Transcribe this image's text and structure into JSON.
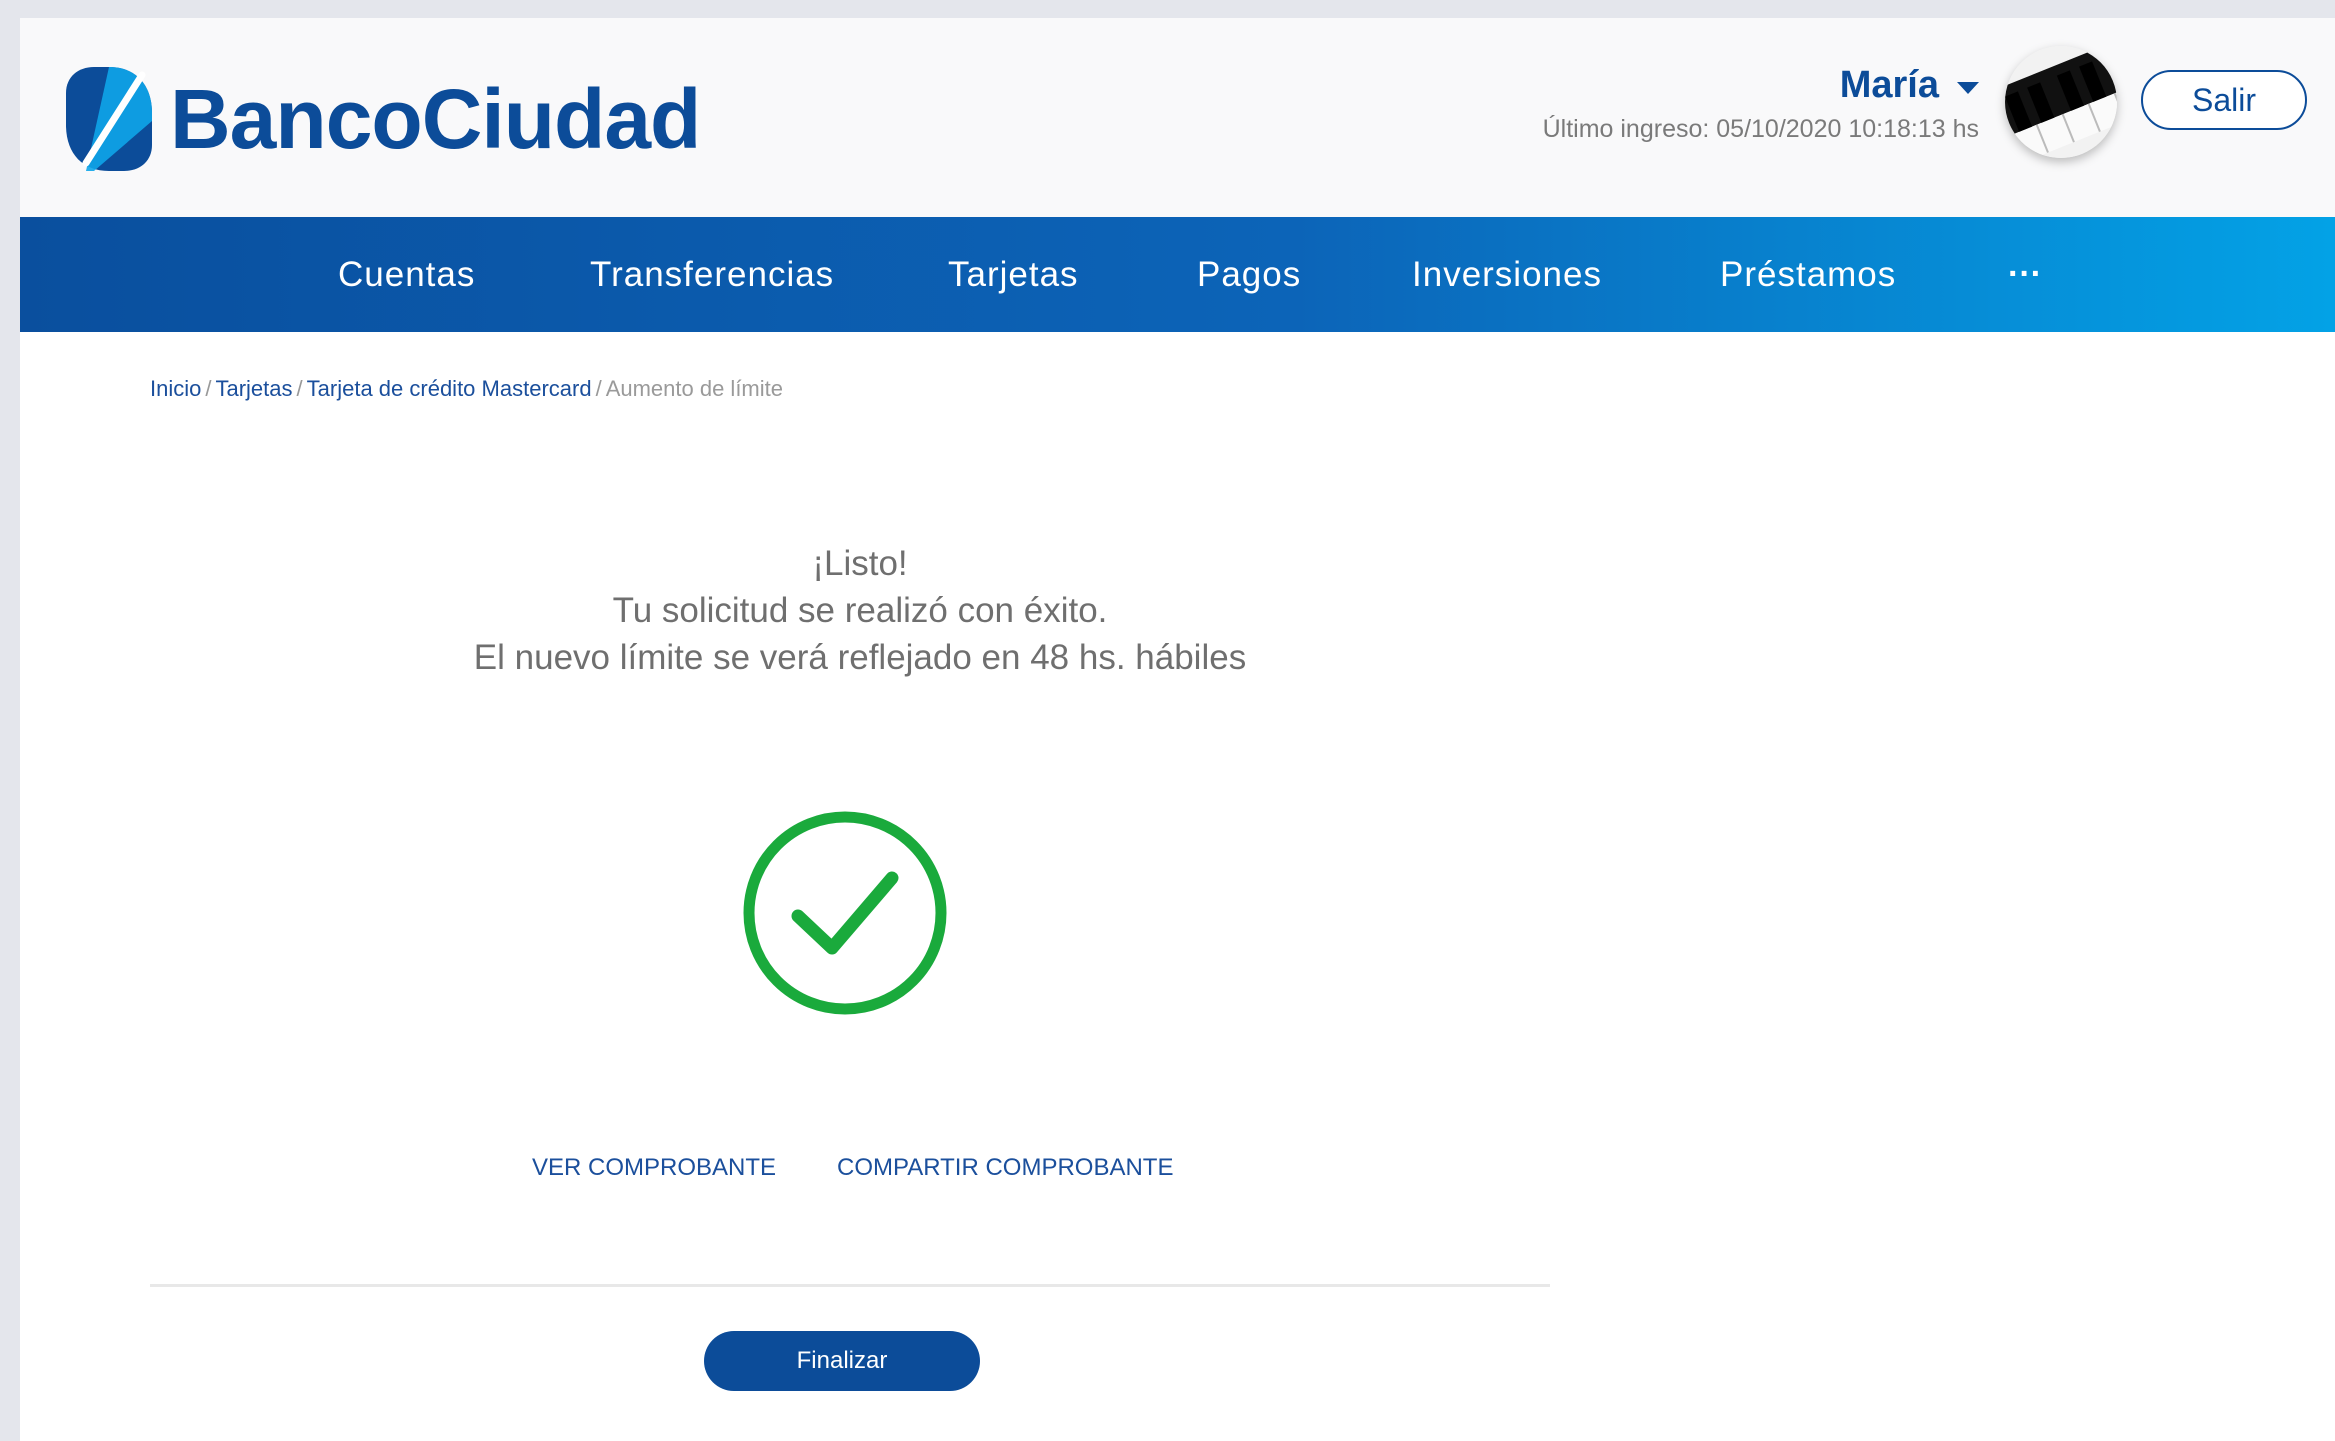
{
  "brand": {
    "name": "BancoCiudad",
    "color": "#0c4c99"
  },
  "user": {
    "name": "María",
    "last_login": "Último ingreso: 05/10/2020 10:18:13 hs",
    "logout_label": "Salir"
  },
  "nav": {
    "items": [
      {
        "label": "Cuentas"
      },
      {
        "label": "Transferencias"
      },
      {
        "label": "Tarjetas"
      },
      {
        "label": "Pagos"
      },
      {
        "label": "Inversiones"
      },
      {
        "label": "Préstamos"
      }
    ],
    "more_label": "···"
  },
  "breadcrumb": {
    "items": [
      "Inicio",
      "Tarjetas",
      "Tarjeta de crédito Mastercard"
    ],
    "separator": "/",
    "current": "Aumento de límite"
  },
  "result": {
    "line1": "¡Listo!",
    "line2": "Tu solicitud se realizó con éxito.",
    "line3": "El nuevo límite se verá reflejado en 48 hs. hábiles",
    "icon": "success-check-icon",
    "icon_color": "#1aaa3c"
  },
  "actions": {
    "view_receipt": "VER COMPROBANTE",
    "share_receipt": "COMPARTIR COMPROBANTE",
    "finish": "Finalizar"
  }
}
